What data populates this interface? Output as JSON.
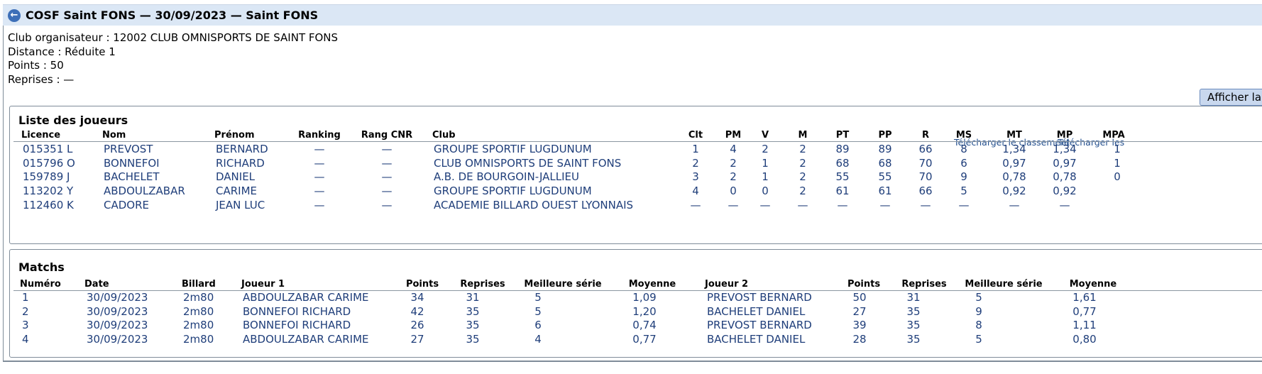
{
  "title": "COSF Saint FONS — 30/09/2023 — Saint FONS",
  "info": [
    "Club organisateur : 12002 CLUB OMNISPORTS DE SAINT FONS",
    "Distance : Réduite 1",
    "Points : 50",
    "Reprises : —"
  ],
  "synth_button": "Afficher la synth",
  "players": {
    "title": "Liste des joueurs",
    "download_ranking": "Télécharger le classement",
    "download_other": "Télécharger les",
    "headers": [
      "Licence",
      "Nom",
      "Prénom",
      "Ranking",
      "Rang CNR",
      "Club",
      "Clt",
      "PM",
      "V",
      "M",
      "PT",
      "PP",
      "R",
      "MS",
      "MT",
      "MP",
      "MPA"
    ],
    "rows": [
      [
        "015351 L",
        "PREVOST",
        "BERNARD",
        "—",
        "—",
        "GROUPE SPORTIF LUGDUNUM",
        "1",
        "4",
        "2",
        "2",
        "89",
        "89",
        "66",
        "8",
        "1,34",
        "1,34",
        "1"
      ],
      [
        "015796 O",
        "BONNEFOI",
        "RICHARD",
        "—",
        "—",
        "CLUB OMNISPORTS DE SAINT FONS",
        "2",
        "2",
        "1",
        "2",
        "68",
        "68",
        "70",
        "6",
        "0,97",
        "0,97",
        "1"
      ],
      [
        "159789 J",
        "BACHELET",
        "DANIEL",
        "—",
        "—",
        "A.B. DE BOURGOIN-JALLIEU",
        "3",
        "2",
        "1",
        "2",
        "55",
        "55",
        "70",
        "9",
        "0,78",
        "0,78",
        "0"
      ],
      [
        "113202 Y",
        "ABDOULZABAR",
        "CARIME",
        "—",
        "—",
        "GROUPE SPORTIF LUGDUNUM",
        "4",
        "0",
        "0",
        "2",
        "61",
        "61",
        "66",
        "5",
        "0,92",
        "0,92",
        ""
      ],
      [
        "112460 K",
        "CADORE",
        "JEAN LUC",
        "—",
        "—",
        "ACADEMIE BILLARD OUEST LYONNAIS",
        "—",
        "—",
        "—",
        "—",
        "—",
        "—",
        "—",
        "—",
        "—",
        "—",
        ""
      ]
    ]
  },
  "matches": {
    "title": "Matchs",
    "headers": [
      "Numéro",
      "Date",
      "Billard",
      "Joueur 1",
      "Points",
      "Reprises",
      "Meilleure série",
      "Moyenne",
      "Joueur 2",
      "Points",
      "Reprises",
      "Meilleure série",
      "Moyenne"
    ],
    "rows": [
      [
        "1",
        "30/09/2023",
        "2m80",
        "ABDOULZABAR CARIME",
        "34",
        "31",
        "5",
        "1,09",
        "PREVOST BERNARD",
        "50",
        "31",
        "5",
        "1,61"
      ],
      [
        "2",
        "30/09/2023",
        "2m80",
        "BONNEFOI RICHARD",
        "42",
        "35",
        "5",
        "1,20",
        "BACHELET DANIEL",
        "27",
        "35",
        "9",
        "0,77"
      ],
      [
        "3",
        "30/09/2023",
        "2m80",
        "BONNEFOI RICHARD",
        "26",
        "35",
        "6",
        "0,74",
        "PREVOST BERNARD",
        "39",
        "35",
        "8",
        "1,11"
      ],
      [
        "4",
        "30/09/2023",
        "2m80",
        "ABDOULZABAR CARIME",
        "27",
        "35",
        "4",
        "0,77",
        "BACHELET DANIEL",
        "28",
        "35",
        "5",
        "0,80"
      ]
    ]
  }
}
